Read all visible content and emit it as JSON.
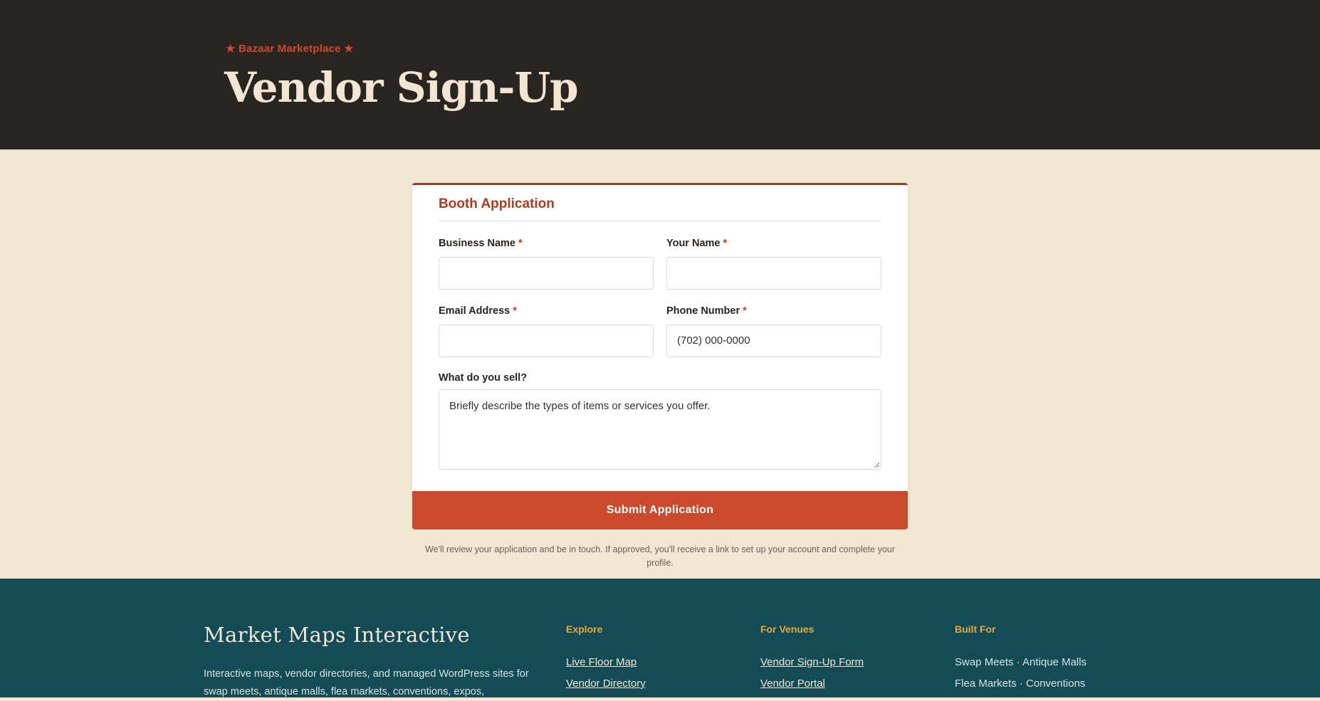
{
  "hero": {
    "eyebrow": "★ Bazaar Marketplace ★",
    "title": "Vendor Sign-Up"
  },
  "form": {
    "title": "Booth Application",
    "required_mark": "*",
    "business_name": {
      "label": "Business Name",
      "value": ""
    },
    "your_name": {
      "label": "Your Name",
      "value": ""
    },
    "email": {
      "label": "Email Address",
      "value": ""
    },
    "phone": {
      "label": "Phone Number",
      "placeholder": "(702) 000-0000"
    },
    "sell": {
      "label": "What do you sell?",
      "placeholder": "Briefly describe the types of items or services you offer."
    },
    "submit_label": "Submit Application",
    "note": "We'll review your application and be in touch. If approved, you'll receive a link to set up your account and complete your profile."
  },
  "footer": {
    "brand": "Market Maps Interactive",
    "description": "Interactive maps, vendor directories, and managed WordPress sites for swap meets, antique malls, flea markets, conventions, expos,",
    "explore": {
      "heading": "Explore",
      "links": [
        "Live Floor Map",
        "Vendor Directory"
      ]
    },
    "venues": {
      "heading": "For Venues",
      "links": [
        "Vendor Sign-Up Form",
        "Vendor Portal"
      ]
    },
    "built_for": {
      "heading": "Built For",
      "items": [
        "Swap Meets · Antique Malls",
        "Flea Markets · Conventions"
      ]
    }
  },
  "colors": {
    "hero_bg": "#2a2521",
    "accent": "#c94a2c",
    "page_bg": "#f2e6d2",
    "footer_bg": "#134c56",
    "footer_heading": "#e7a93a"
  }
}
